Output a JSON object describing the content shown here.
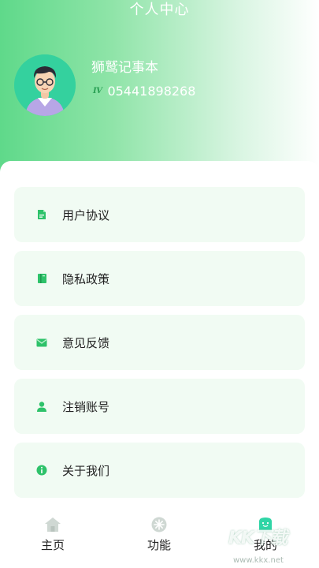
{
  "header": {
    "title": "个人中心",
    "profile_name": "狮鹫记事本",
    "id_icon": "IV",
    "id_number": "05441898268"
  },
  "menu": {
    "items": [
      {
        "label": "用户协议",
        "icon": "document-icon"
      },
      {
        "label": "隐私政策",
        "icon": "notebook-icon"
      },
      {
        "label": "意见反馈",
        "icon": "envelope-icon"
      },
      {
        "label": "注销账号",
        "icon": "user-icon"
      },
      {
        "label": "关于我们",
        "icon": "info-icon"
      }
    ]
  },
  "tabbar": {
    "tabs": [
      {
        "label": "主页",
        "icon": "home-icon",
        "active": false
      },
      {
        "label": "功能",
        "icon": "function-icon",
        "active": false
      },
      {
        "label": "我的",
        "icon": "profile-icon",
        "active": true
      }
    ]
  },
  "watermark": {
    "text": "KK下载",
    "url": "www.kkx.net"
  },
  "colors": {
    "accent": "#2ec26a",
    "card_bg": "#f1fbf3",
    "header_gradient_start": "#5fd98a"
  }
}
